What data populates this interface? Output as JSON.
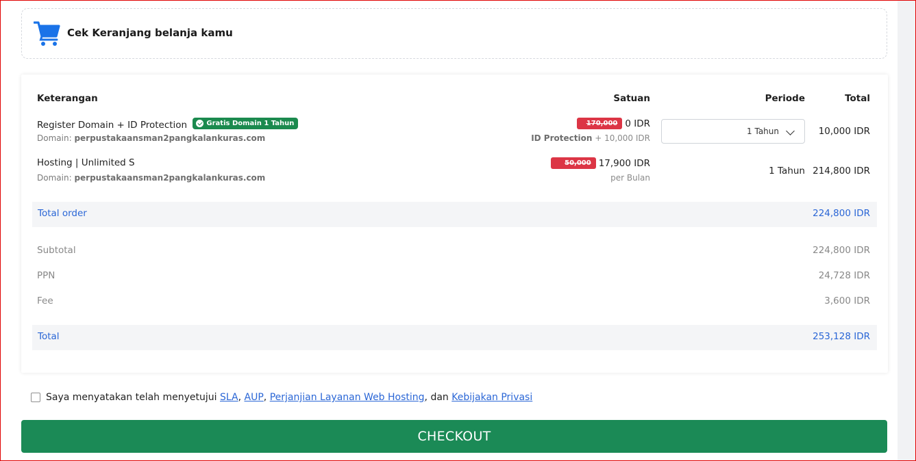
{
  "header": {
    "title": "Cek Keranjang belanja kamu",
    "icon": "shopping-cart-icon",
    "icon_color": "#1a73e8"
  },
  "table": {
    "columns": {
      "description": "Keterangan",
      "unit": "Satuan",
      "period": "Periode",
      "total": "Total"
    },
    "items": [
      {
        "name": "Register Domain + ID Protection",
        "badge": "Gratis Domain 1 Tahun",
        "domain_label": "Domain:",
        "domain": "perpustakaansman2pangkalankuras.com",
        "old_price": "170,000",
        "price": "0 IDR",
        "sub_bold": "ID Protection",
        "sub_text": "+ 10,000 IDR",
        "period_selected": "1 Tahun",
        "total": "10,000 IDR"
      },
      {
        "name": "Hosting | Unlimited S",
        "domain_label": "Domain:",
        "domain": "perpustakaansman2pangkalankuras.com",
        "old_price": "50,000",
        "price": "17,900 IDR",
        "sub_text": "per Bulan",
        "period": "1 Tahun",
        "total": "214,800 IDR"
      }
    ]
  },
  "totals": {
    "order_label": "Total order",
    "order_value": "224,800 IDR",
    "subtotal_label": "Subtotal",
    "subtotal_value": "224,800 IDR",
    "ppn_label": "PPN",
    "ppn_value": "24,728 IDR",
    "fee_label": "Fee",
    "fee_value": "3,600 IDR",
    "total_label": "Total",
    "total_value": "253,128 IDR"
  },
  "agreement": {
    "prefix": "Saya menyatakan telah menyetujui",
    "link_sla": "SLA",
    "link_aup": "AUP",
    "link_terms": "Perjanjian Layanan Web Hosting",
    "conjunction": ", dan",
    "link_privacy": "Kebijakan Privasi",
    "checked": false
  },
  "checkout_label": "CHECKOUT",
  "colors": {
    "accent": "#2a66d6",
    "checkout": "#1b8a56",
    "badge_free": "#1b8a4e",
    "badge_discount": "#dc3545"
  }
}
